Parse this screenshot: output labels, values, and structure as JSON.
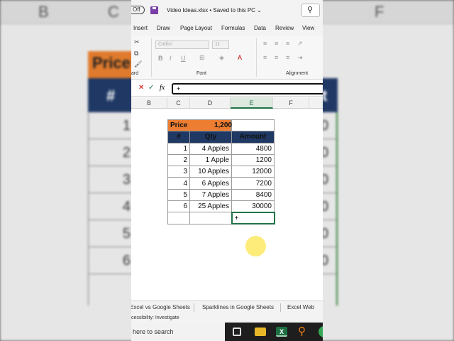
{
  "background": {
    "col_letters": [
      "B",
      "C",
      "F"
    ],
    "price_label": "Price",
    "hash": "#",
    "amount_fragment": "t",
    "row_numbers": [
      "1",
      "2",
      "3",
      "4",
      "5",
      "6"
    ],
    "amount_endings": [
      "0",
      "0",
      "0",
      "0",
      "0",
      "0"
    ]
  },
  "titlebar": {
    "autosave_toggle": "Off",
    "document_title": "Video Ideas.xlsx • Saved to this PC ⌄"
  },
  "ribbon_tabs": [
    "Insert",
    "Draw",
    "Page Layout",
    "Formulas",
    "Data",
    "Review",
    "View"
  ],
  "ribbon": {
    "font_name": "Calibri",
    "font_size": "11",
    "clipboard_label": "ard",
    "font_group_label": "Font",
    "alignment_group_label": "Alignment"
  },
  "formula_bar": {
    "cancel_glyph": "✕",
    "enter_glyph": "✓",
    "fx_label": "fx",
    "content": "+"
  },
  "columns": [
    "B",
    "C",
    "D",
    "E",
    "F"
  ],
  "selected_column": "E",
  "table": {
    "price_label": "Price",
    "price_value": "1,200",
    "headers": [
      "#",
      "Qty",
      "Amount"
    ],
    "rows": [
      {
        "n": "1",
        "qty": "4 Apples",
        "amount": "4800"
      },
      {
        "n": "2",
        "qty": "1 Apple",
        "amount": "1200"
      },
      {
        "n": "3",
        "qty": "10 Apples",
        "amount": "12000"
      },
      {
        "n": "4",
        "qty": "6 Apples",
        "amount": "7200"
      },
      {
        "n": "5",
        "qty": "7 Apples",
        "amount": "8400"
      },
      {
        "n": "6",
        "qty": "25 Apples",
        "amount": "30000"
      }
    ],
    "active_cell_text": "+"
  },
  "sheet_tabs": [
    "Excel vs Google Sheets",
    "Sparklines in Google Sheets",
    "Excel Web"
  ],
  "status": {
    "accessibility": "cessibility: Investigate"
  },
  "taskbar": {
    "search_text": "here to search"
  },
  "colors": {
    "excel_green": "#217346",
    "orange": "#ed7d31",
    "navy": "#1f3864",
    "click_highlight": "#fdea6b"
  }
}
